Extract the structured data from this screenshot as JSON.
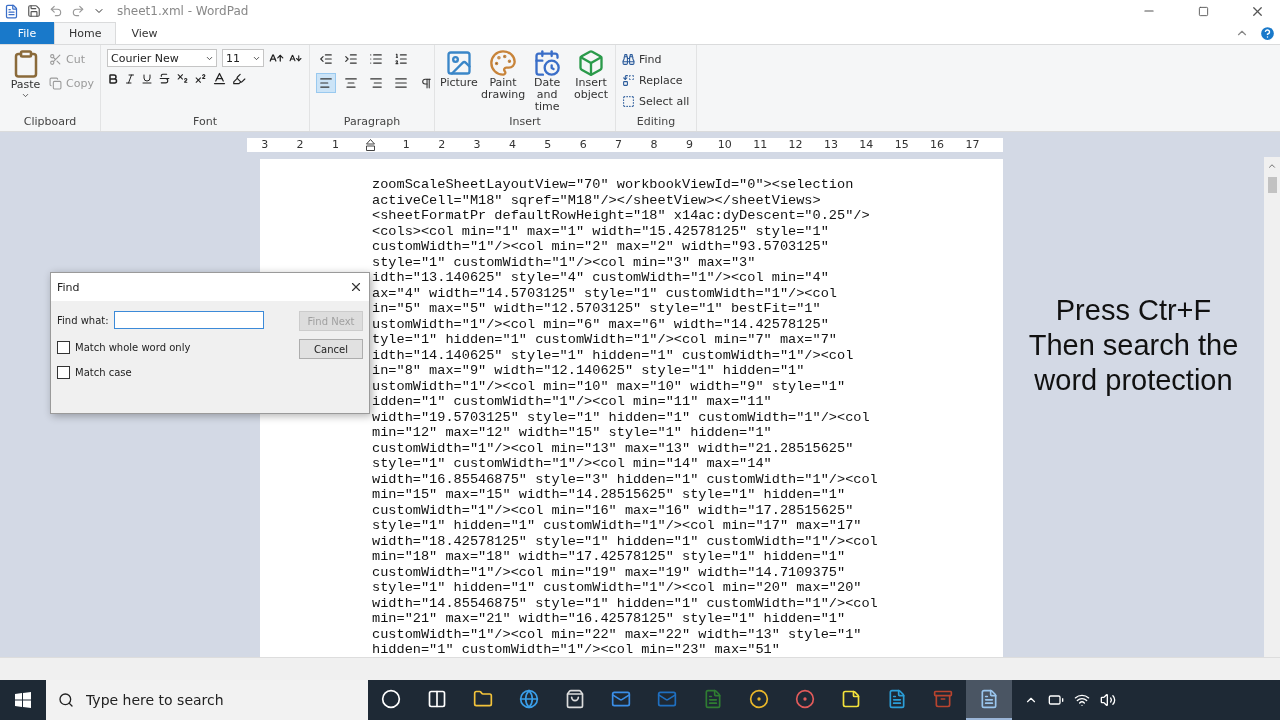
{
  "window": {
    "title": "sheet1.xml - WordPad"
  },
  "ribbon_tabs": [
    {
      "label": "File",
      "kind": "file",
      "selected": false
    },
    {
      "label": "Home",
      "kind": "tab",
      "selected": true
    },
    {
      "label": "View",
      "kind": "tab",
      "selected": false
    }
  ],
  "clipboard": {
    "label": "Clipboard",
    "paste": "Paste",
    "items": [
      {
        "label": "Cut",
        "kind": "cut",
        "disabled": true
      },
      {
        "label": "Copy",
        "kind": "copy",
        "disabled": true
      }
    ]
  },
  "font": {
    "label": "Font",
    "family": "Courier New",
    "size": "11"
  },
  "paragraph": {
    "label": "Paragraph",
    "alignment_buttons": [
      {
        "kind": "left",
        "selected": true
      },
      {
        "kind": "center",
        "selected": false
      },
      {
        "kind": "right",
        "selected": false
      },
      {
        "kind": "justify",
        "selected": false
      }
    ]
  },
  "insert": {
    "label": "Insert",
    "items": [
      {
        "label": "Picture",
        "kind": "picture"
      },
      {
        "label": "Paint drawing",
        "kind": "paint"
      },
      {
        "label": "Date and time",
        "kind": "date"
      },
      {
        "label": "Insert object",
        "kind": "object"
      }
    ]
  },
  "editing": {
    "label": "Editing",
    "items": [
      {
        "label": "Find",
        "kind": "find"
      },
      {
        "label": "Replace",
        "kind": "replace"
      },
      {
        "label": "Select all",
        "kind": "select"
      }
    ]
  },
  "ruler": {
    "left_labels": [
      "3",
      "2",
      "1"
    ],
    "right_labels": [
      "1",
      "2",
      "3",
      "4",
      "5",
      "6",
      "7",
      "8",
      "9",
      "10",
      "11",
      "12",
      "13",
      "14",
      "15",
      "16",
      "17"
    ]
  },
  "document": {
    "lines": [
      "zoomScaleSheetLayoutView=\"70\" workbookViewId=\"0\"><selection",
      "activeCell=\"M18\" sqref=\"M18\"/></sheetView></sheetViews>",
      "<sheetFormatPr defaultRowHeight=\"18\" x14ac:dyDescent=\"0.25\"/>",
      "<cols><col min=\"1\" max=\"1\" width=\"15.42578125\" style=\"1\"",
      "customWidth=\"1\"/><col min=\"2\" max=\"2\" width=\"93.5703125\"",
      "style=\"1\" customWidth=\"1\"/><col min=\"3\" max=\"3\"",
      "idth=\"13.140625\" style=\"4\" customWidth=\"1\"/><col min=\"4\"",
      "ax=\"4\" width=\"14.5703125\" style=\"1\" customWidth=\"1\"/><col",
      "in=\"5\" max=\"5\" width=\"12.5703125\" style=\"1\" bestFit=\"1\"",
      "ustomWidth=\"1\"/><col min=\"6\" max=\"6\" width=\"14.42578125\"",
      "tyle=\"1\" hidden=\"1\" customWidth=\"1\"/><col min=\"7\" max=\"7\"",
      "idth=\"14.140625\" style=\"1\" hidden=\"1\" customWidth=\"1\"/><col",
      "in=\"8\" max=\"9\" width=\"12.140625\" style=\"1\" hidden=\"1\"",
      "ustomWidth=\"1\"/><col min=\"10\" max=\"10\" width=\"9\" style=\"1\"",
      "idden=\"1\" customWidth=\"1\"/><col min=\"11\" max=\"11\"",
      "width=\"19.5703125\" style=\"1\" hidden=\"1\" customWidth=\"1\"/><col",
      "min=\"12\" max=\"12\" width=\"15\" style=\"1\" hidden=\"1\"",
      "customWidth=\"1\"/><col min=\"13\" max=\"13\" width=\"21.28515625\"",
      "style=\"1\" customWidth=\"1\"/><col min=\"14\" max=\"14\"",
      "width=\"16.85546875\" style=\"3\" hidden=\"1\" customWidth=\"1\"/><col",
      "min=\"15\" max=\"15\" width=\"14.28515625\" style=\"1\" hidden=\"1\"",
      "customWidth=\"1\"/><col min=\"16\" max=\"16\" width=\"17.28515625\"",
      "style=\"1\" hidden=\"1\" customWidth=\"1\"/><col min=\"17\" max=\"17\"",
      "width=\"18.42578125\" style=\"1\" hidden=\"1\" customWidth=\"1\"/><col",
      "min=\"18\" max=\"18\" width=\"17.42578125\" style=\"1\" hidden=\"1\"",
      "customWidth=\"1\"/><col min=\"19\" max=\"19\" width=\"14.7109375\"",
      "style=\"1\" hidden=\"1\" customWidth=\"1\"/><col min=\"20\" max=\"20\"",
      "width=\"14.85546875\" style=\"1\" hidden=\"1\" customWidth=\"1\"/><col",
      "min=\"21\" max=\"21\" width=\"16.42578125\" style=\"1\" hidden=\"1\"",
      "customWidth=\"1\"/><col min=\"22\" max=\"22\" width=\"13\" style=\"1\"",
      "hidden=\"1\" customWidth=\"1\"/><col min=\"23\" max=\"51\""
    ]
  },
  "find_dialog": {
    "title": "Find",
    "find_what_label": "Find what:",
    "options": [
      {
        "label": "Match whole word only",
        "checked": false
      },
      {
        "label": "Match case",
        "checked": false
      }
    ],
    "buttons": [
      {
        "label": "Find Next",
        "disabled": true
      },
      {
        "label": "Cancel",
        "disabled": false
      }
    ]
  },
  "annotation": {
    "lines": [
      "Press Ctr+F",
      "Then search the",
      "word protection"
    ]
  },
  "taskbar": {
    "search": {
      "placeholder": "Type here to search"
    },
    "apps": [
      {
        "kind": "cortana",
        "selected": false
      },
      {
        "kind": "taskview",
        "selected": false
      },
      {
        "kind": "explorer",
        "selected": false
      },
      {
        "kind": "edge",
        "selected": false
      },
      {
        "kind": "store",
        "selected": false
      },
      {
        "kind": "mail",
        "selected": false
      },
      {
        "kind": "outlook",
        "selected": false
      },
      {
        "kind": "project",
        "selected": false
      },
      {
        "kind": "chrome",
        "selected": false
      },
      {
        "kind": "reader",
        "selected": false
      },
      {
        "kind": "sticky",
        "selected": false
      },
      {
        "kind": "sapp",
        "selected": false
      },
      {
        "kind": "archive",
        "selected": false
      },
      {
        "kind": "wordpad",
        "selected": true
      }
    ]
  }
}
